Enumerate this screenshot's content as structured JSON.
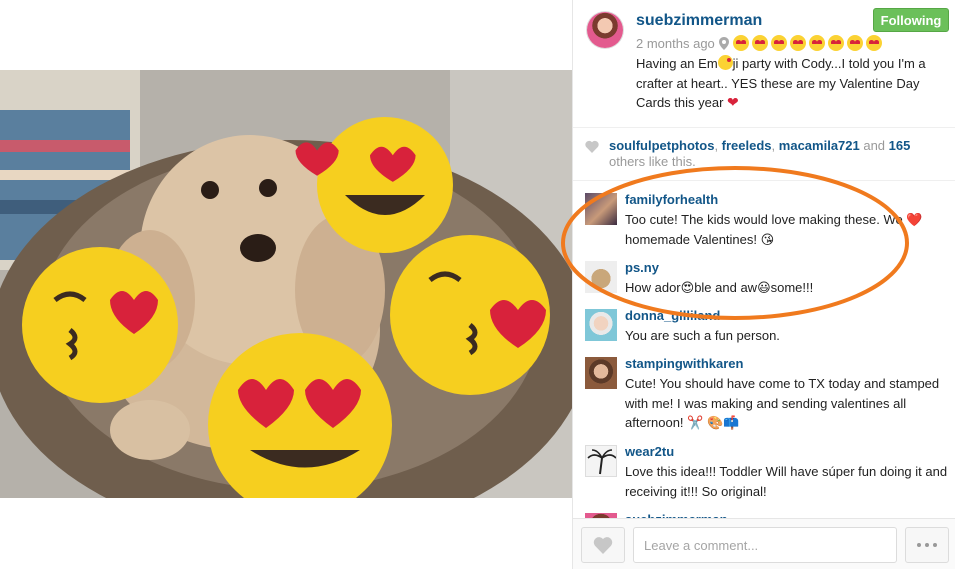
{
  "post": {
    "username": "suebzimmerman",
    "follow_label": "Following",
    "time_ago": "2 months ago",
    "caption_parts": [
      "Having an Em",
      "ji party with Cody...I told you I'm a crafter at heart.. YES these are my Valentine Day Cards this year "
    ]
  },
  "likes": {
    "user1": "soulfulpetphotos",
    "sep1": ", ",
    "user2": "freeleds",
    "sep2": ", ",
    "user3": "macamila721",
    "and_text": " and ",
    "count": "165",
    "tail": " others like this."
  },
  "comments": [
    {
      "user": "familyforhealth",
      "text": "Too cute! The kids would love making these. We ❤️ homemade Valentines! 😘"
    },
    {
      "user": "ps.ny",
      "text": "How ador😍ble and aw😃some!!!"
    },
    {
      "user": "donna_gilliland",
      "text": "You are such a fun person."
    },
    {
      "user": "stampingwithkaren",
      "text": "Cute! You should have come to TX today and stamped with me! I was making and sending valentines all afternoon! ✂️ 🎨📫"
    },
    {
      "user": "wear2tu",
      "text": "Love this idea!!! Toddler Will have súper fun doing it and receiving it!!! So original!"
    },
    {
      "user": "suebzimmerman",
      "text": ""
    }
  ],
  "footer": {
    "comment_placeholder": "Leave a comment..."
  },
  "colors": {
    "link": "#125688",
    "following_green": "#6bc05a",
    "highlight_orange": "#f07a1e"
  },
  "icons": [
    "pin-icon",
    "heart-icon",
    "more-icon"
  ]
}
